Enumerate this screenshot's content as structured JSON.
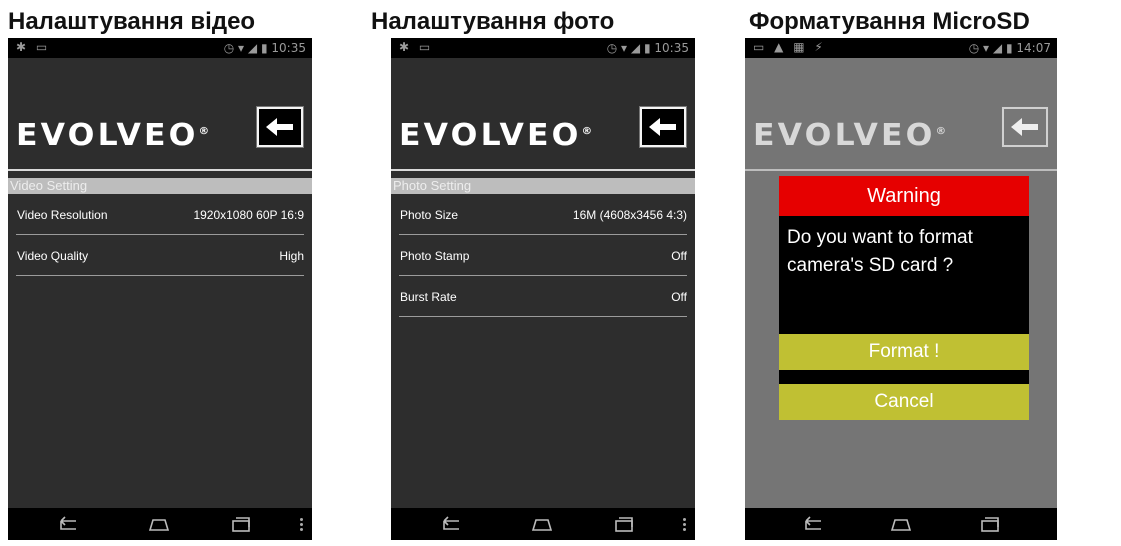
{
  "captions": {
    "video": "Налаштування відео",
    "photo": "Налаштування фото",
    "format": "Форматування MicroSD"
  },
  "status_bar": {
    "time_1": "10:35",
    "time_2": "10:35",
    "time_3": "14:07"
  },
  "brand": {
    "logo": "EVOLVEO",
    "mark": "®"
  },
  "video_screen": {
    "section": "Video Setting",
    "rows": [
      {
        "label": "Video Resolution",
        "value": "1920x1080 60P 16:9"
      },
      {
        "label": "Video Quality",
        "value": "High"
      }
    ]
  },
  "photo_screen": {
    "section": "Photo Setting",
    "rows": [
      {
        "label": "Photo Size",
        "value": "16M (4608x3456 4:3)"
      },
      {
        "label": "Photo Stamp",
        "value": "Off"
      },
      {
        "label": "Burst Rate",
        "value": "Off"
      }
    ]
  },
  "format_dialog": {
    "title": "Warning",
    "message": "Do you want to format camera's SD card ?",
    "confirm_label": "Format !",
    "cancel_label": "Cancel"
  },
  "colors": {
    "warning_red": "#e60000",
    "button_olive": "#c0c033",
    "screen_bg": "#2d2d2d",
    "dialog_bg": "#757575"
  },
  "icons": [
    "back-arrow-icon",
    "nav-back-icon",
    "nav-home-icon",
    "nav-recents-icon",
    "overflow-menu-icon",
    "alarm-icon",
    "wifi-icon",
    "signal-icon",
    "battery-icon"
  ]
}
